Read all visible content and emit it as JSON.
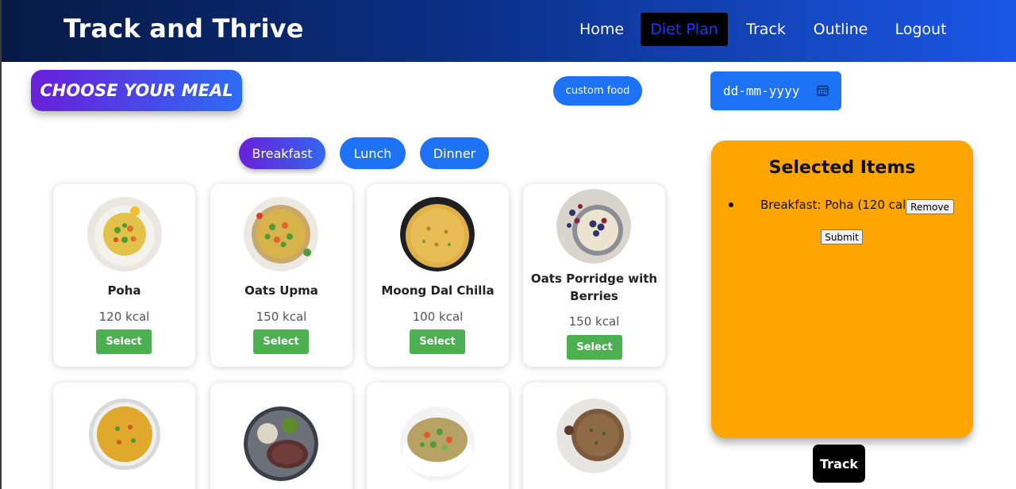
{
  "header": {
    "title": "Track and Thrive",
    "nav": [
      {
        "label": "Home"
      },
      {
        "label": "Diet Plan"
      },
      {
        "label": "Track"
      },
      {
        "label": "Outline"
      },
      {
        "label": "Logout"
      }
    ]
  },
  "main": {
    "choose_label": "CHOOSE YOUR MEAL",
    "custom_food_label": "custom food",
    "date_placeholder": "dd-mm-yyyy",
    "tabs": [
      {
        "label": "Breakfast"
      },
      {
        "label": "Lunch"
      },
      {
        "label": "Dinner"
      }
    ],
    "foods": [
      {
        "name": "Poha",
        "kcal": "120 kcal",
        "select": "Select"
      },
      {
        "name": "Oats Upma",
        "kcal": "150 kcal",
        "select": "Select"
      },
      {
        "name": "Moong Dal Chilla",
        "kcal": "100 kcal",
        "select": "Select"
      },
      {
        "name": "Oats Porridge with Berries",
        "kcal": "150 kcal",
        "select": "Select"
      }
    ]
  },
  "panel": {
    "title": "Selected Items",
    "items": [
      {
        "text": "Breakfast: Poha (120 cal)",
        "remove": "Remove"
      }
    ],
    "submit_label": "Submit"
  },
  "track_label": "Track",
  "colors": {
    "accent": "#1e72f5",
    "panel": "#ffa500",
    "select": "#4caf50"
  }
}
